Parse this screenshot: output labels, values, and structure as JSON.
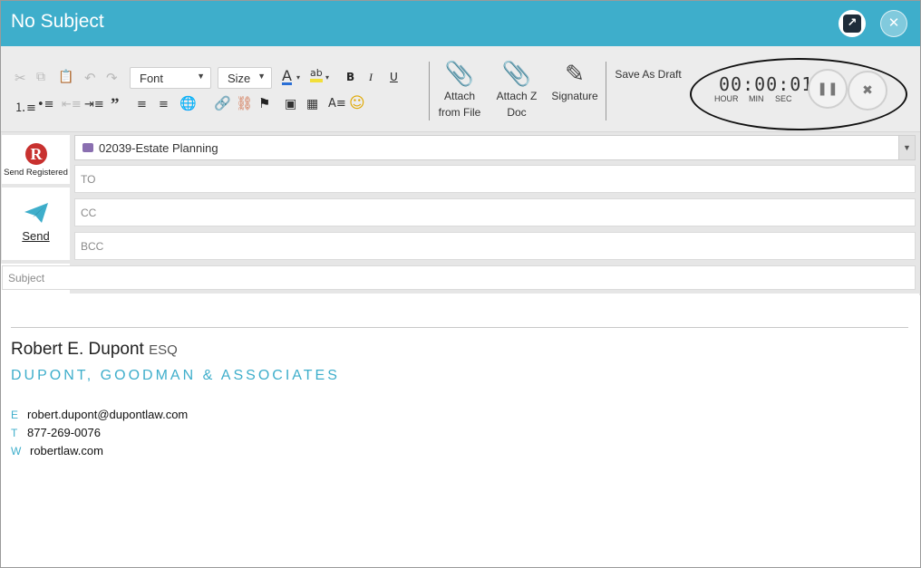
{
  "window": {
    "title": "No Subject"
  },
  "toolbar": {
    "font_label": "Font",
    "size_label": "Size",
    "bold": "B",
    "italic": "I",
    "underline": "U",
    "attach_file_label_1": "Attach",
    "attach_file_label_2": "from File",
    "attach_doc_label_1": "Attach Z",
    "attach_doc_label_2": "Doc",
    "signature_label": "Signature",
    "save_draft_label": "Save As Draft"
  },
  "timer": {
    "display": "00:00:01",
    "hour_label": "HOUR",
    "min_label": "MIN",
    "sec_label": "SEC"
  },
  "actions": {
    "send_registered_label": "Send Registered",
    "send_label": "Send"
  },
  "fields": {
    "matter": "02039-Estate Planning",
    "to_placeholder": "TO",
    "cc_placeholder": "CC",
    "bcc_placeholder": "BCC",
    "subject_placeholder": "Subject"
  },
  "signature": {
    "name": "Robert E. Dupont",
    "suffix": "ESQ",
    "firm": "DUPONT, GOODMAN & ASSOCIATES",
    "email_key": "E",
    "email": "robert.dupont@dupontlaw.com",
    "phone_key": "T",
    "phone": "877-269-0076",
    "web_key": "W",
    "web": "robertlaw.com"
  },
  "colors": {
    "accent": "#3eaecb",
    "registered_red": "#c8312f"
  }
}
